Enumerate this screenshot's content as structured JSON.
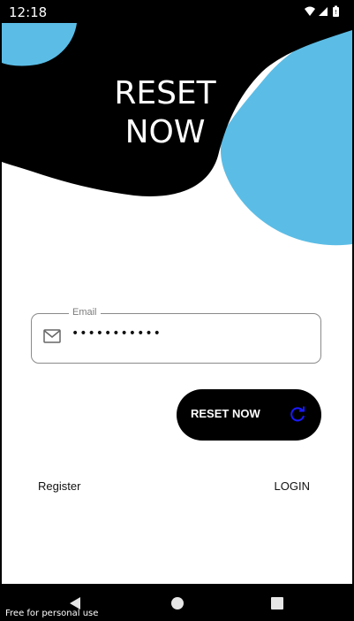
{
  "status_bar": {
    "time": "12:18",
    "icons": [
      "wifi-icon",
      "signal-icon",
      "battery-icon"
    ]
  },
  "header": {
    "title_line1": "RESET",
    "title_line2": "NOW"
  },
  "form": {
    "email_label": "Email",
    "email_value": "•••••••••••",
    "email_icon": "mail-icon"
  },
  "reset_button": {
    "label": "RESET NOW",
    "icon": "refresh-icon"
  },
  "links": {
    "register": "Register",
    "login": "LOGIN"
  },
  "nav_bar": {
    "buttons": [
      "back-icon",
      "home-icon",
      "recents-icon"
    ],
    "watermark": "Free for personal use"
  },
  "colors": {
    "accent_blue": "#5bbde6",
    "dark": "#000000",
    "refresh_icon": "#1a1aff"
  }
}
